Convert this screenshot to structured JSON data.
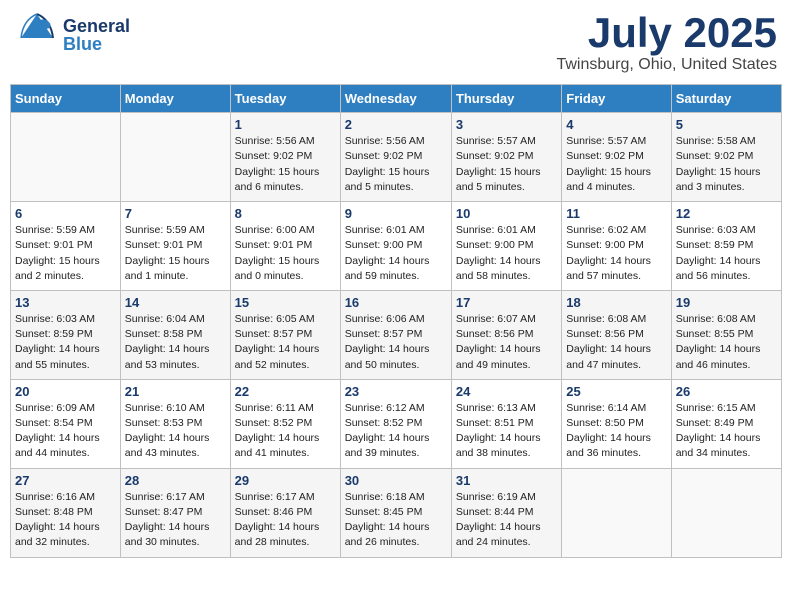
{
  "header": {
    "logo_general": "General",
    "logo_blue": "Blue",
    "month_title": "July 2025",
    "location": "Twinsburg, Ohio, United States"
  },
  "calendar": {
    "days_of_week": [
      "Sunday",
      "Monday",
      "Tuesday",
      "Wednesday",
      "Thursday",
      "Friday",
      "Saturday"
    ],
    "weeks": [
      [
        {
          "day": "",
          "info": ""
        },
        {
          "day": "",
          "info": ""
        },
        {
          "day": "1",
          "info": "Sunrise: 5:56 AM\nSunset: 9:02 PM\nDaylight: 15 hours\nand 6 minutes."
        },
        {
          "day": "2",
          "info": "Sunrise: 5:56 AM\nSunset: 9:02 PM\nDaylight: 15 hours\nand 5 minutes."
        },
        {
          "day": "3",
          "info": "Sunrise: 5:57 AM\nSunset: 9:02 PM\nDaylight: 15 hours\nand 5 minutes."
        },
        {
          "day": "4",
          "info": "Sunrise: 5:57 AM\nSunset: 9:02 PM\nDaylight: 15 hours\nand 4 minutes."
        },
        {
          "day": "5",
          "info": "Sunrise: 5:58 AM\nSunset: 9:02 PM\nDaylight: 15 hours\nand 3 minutes."
        }
      ],
      [
        {
          "day": "6",
          "info": "Sunrise: 5:59 AM\nSunset: 9:01 PM\nDaylight: 15 hours\nand 2 minutes."
        },
        {
          "day": "7",
          "info": "Sunrise: 5:59 AM\nSunset: 9:01 PM\nDaylight: 15 hours\nand 1 minute."
        },
        {
          "day": "8",
          "info": "Sunrise: 6:00 AM\nSunset: 9:01 PM\nDaylight: 15 hours\nand 0 minutes."
        },
        {
          "day": "9",
          "info": "Sunrise: 6:01 AM\nSunset: 9:00 PM\nDaylight: 14 hours\nand 59 minutes."
        },
        {
          "day": "10",
          "info": "Sunrise: 6:01 AM\nSunset: 9:00 PM\nDaylight: 14 hours\nand 58 minutes."
        },
        {
          "day": "11",
          "info": "Sunrise: 6:02 AM\nSunset: 9:00 PM\nDaylight: 14 hours\nand 57 minutes."
        },
        {
          "day": "12",
          "info": "Sunrise: 6:03 AM\nSunset: 8:59 PM\nDaylight: 14 hours\nand 56 minutes."
        }
      ],
      [
        {
          "day": "13",
          "info": "Sunrise: 6:03 AM\nSunset: 8:59 PM\nDaylight: 14 hours\nand 55 minutes."
        },
        {
          "day": "14",
          "info": "Sunrise: 6:04 AM\nSunset: 8:58 PM\nDaylight: 14 hours\nand 53 minutes."
        },
        {
          "day": "15",
          "info": "Sunrise: 6:05 AM\nSunset: 8:57 PM\nDaylight: 14 hours\nand 52 minutes."
        },
        {
          "day": "16",
          "info": "Sunrise: 6:06 AM\nSunset: 8:57 PM\nDaylight: 14 hours\nand 50 minutes."
        },
        {
          "day": "17",
          "info": "Sunrise: 6:07 AM\nSunset: 8:56 PM\nDaylight: 14 hours\nand 49 minutes."
        },
        {
          "day": "18",
          "info": "Sunrise: 6:08 AM\nSunset: 8:56 PM\nDaylight: 14 hours\nand 47 minutes."
        },
        {
          "day": "19",
          "info": "Sunrise: 6:08 AM\nSunset: 8:55 PM\nDaylight: 14 hours\nand 46 minutes."
        }
      ],
      [
        {
          "day": "20",
          "info": "Sunrise: 6:09 AM\nSunset: 8:54 PM\nDaylight: 14 hours\nand 44 minutes."
        },
        {
          "day": "21",
          "info": "Sunrise: 6:10 AM\nSunset: 8:53 PM\nDaylight: 14 hours\nand 43 minutes."
        },
        {
          "day": "22",
          "info": "Sunrise: 6:11 AM\nSunset: 8:52 PM\nDaylight: 14 hours\nand 41 minutes."
        },
        {
          "day": "23",
          "info": "Sunrise: 6:12 AM\nSunset: 8:52 PM\nDaylight: 14 hours\nand 39 minutes."
        },
        {
          "day": "24",
          "info": "Sunrise: 6:13 AM\nSunset: 8:51 PM\nDaylight: 14 hours\nand 38 minutes."
        },
        {
          "day": "25",
          "info": "Sunrise: 6:14 AM\nSunset: 8:50 PM\nDaylight: 14 hours\nand 36 minutes."
        },
        {
          "day": "26",
          "info": "Sunrise: 6:15 AM\nSunset: 8:49 PM\nDaylight: 14 hours\nand 34 minutes."
        }
      ],
      [
        {
          "day": "27",
          "info": "Sunrise: 6:16 AM\nSunset: 8:48 PM\nDaylight: 14 hours\nand 32 minutes."
        },
        {
          "day": "28",
          "info": "Sunrise: 6:17 AM\nSunset: 8:47 PM\nDaylight: 14 hours\nand 30 minutes."
        },
        {
          "day": "29",
          "info": "Sunrise: 6:17 AM\nSunset: 8:46 PM\nDaylight: 14 hours\nand 28 minutes."
        },
        {
          "day": "30",
          "info": "Sunrise: 6:18 AM\nSunset: 8:45 PM\nDaylight: 14 hours\nand 26 minutes."
        },
        {
          "day": "31",
          "info": "Sunrise: 6:19 AM\nSunset: 8:44 PM\nDaylight: 14 hours\nand 24 minutes."
        },
        {
          "day": "",
          "info": ""
        },
        {
          "day": "",
          "info": ""
        }
      ]
    ]
  }
}
